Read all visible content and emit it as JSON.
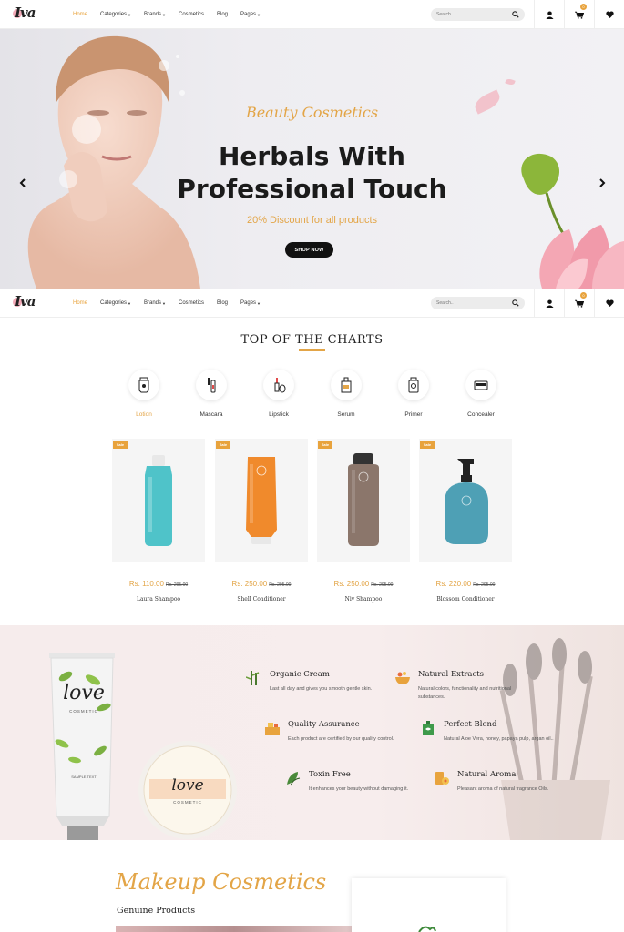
{
  "brand": {
    "logo_text": "Iva"
  },
  "nav": {
    "items": [
      {
        "label": "Home",
        "active": true,
        "has_caret": false
      },
      {
        "label": "Categories",
        "active": false,
        "has_caret": true
      },
      {
        "label": "Brands",
        "active": false,
        "has_caret": true
      },
      {
        "label": "Cosmetics",
        "active": false,
        "has_caret": false
      },
      {
        "label": "Blog",
        "active": false,
        "has_caret": false
      },
      {
        "label": "Pages",
        "active": false,
        "has_caret": true
      }
    ],
    "search_placeholder": "Search..",
    "cart_count": "0",
    "icons": [
      "user-icon",
      "cart-icon",
      "heart-icon"
    ]
  },
  "hero": {
    "script_title": "Beauty Cosmetics",
    "headline_line1": "Herbals With",
    "headline_line2": "Professional Touch",
    "discount": "20% Discount for all products",
    "button": "SHOP NOW"
  },
  "charts": {
    "title": "TOP OF THE CHARTS",
    "categories": [
      {
        "label": "Lotion",
        "icon": "lotion-icon",
        "active": true
      },
      {
        "label": "Mascara",
        "icon": "mascara-icon",
        "active": false
      },
      {
        "label": "Lipstick",
        "icon": "lipstick-icon",
        "active": false
      },
      {
        "label": "Serum",
        "icon": "serum-icon",
        "active": false
      },
      {
        "label": "Primer",
        "icon": "primer-icon",
        "active": false
      },
      {
        "label": "Concealer",
        "icon": "concealer-icon",
        "active": false
      }
    ],
    "products": [
      {
        "badge": "Sale",
        "price": "Rs. 110.00",
        "old_price": "Rs. 295.00",
        "name": "Laura Shampoo",
        "color": "#4fc3c9"
      },
      {
        "badge": "Sale",
        "price": "Rs. 250.00",
        "old_price": "Rs. 295.00",
        "name": "Shell Conditioner",
        "color": "#f08a2c"
      },
      {
        "badge": "Sale",
        "price": "Rs. 250.00",
        "old_price": "Rs. 295.00",
        "name": "Niv Shampoo",
        "color": "#8b766b"
      },
      {
        "badge": "Sale",
        "price": "Rs. 220.00",
        "old_price": "Rs. 295.00",
        "name": "Blossom Conditioner",
        "color": "#4ea0b5"
      }
    ]
  },
  "features": {
    "tube_text": "love",
    "tube_sub": "COSMETIC",
    "tube_sample": "SAMPLE TEXT",
    "jar_text": "love",
    "jar_sub": "COSMETIC",
    "items": [
      {
        "title": "Organic Cream",
        "desc": "Last all day and gives you smooth gentle skin.",
        "icon": "bamboo-icon"
      },
      {
        "title": "Natural Extracts",
        "desc": "Natural colors, functionality and nutritional substances.",
        "icon": "bowl-icon"
      },
      {
        "title": "Quality Assurance",
        "desc": "Each product are certified by our quality control.",
        "icon": "gift-icon"
      },
      {
        "title": "Perfect Blend",
        "desc": "Natural Aloe Vera, honey, papaya pulp, argan oil..",
        "icon": "bottle-icon"
      },
      {
        "title": "Toxin Free",
        "desc": "It enhances your beauty without damaging it.",
        "icon": "leaves-icon"
      },
      {
        "title": "Natural Aroma",
        "desc": "Pleasant aroma of natural fragrance Oils.",
        "icon": "flower-jar-icon"
      }
    ]
  },
  "makeup": {
    "script_title": "Makeup Cosmetics",
    "subtitle": "Genuine Products"
  },
  "colors": {
    "accent": "#e3a547",
    "dark": "#111111",
    "pink_bg": "#f6ecec"
  }
}
